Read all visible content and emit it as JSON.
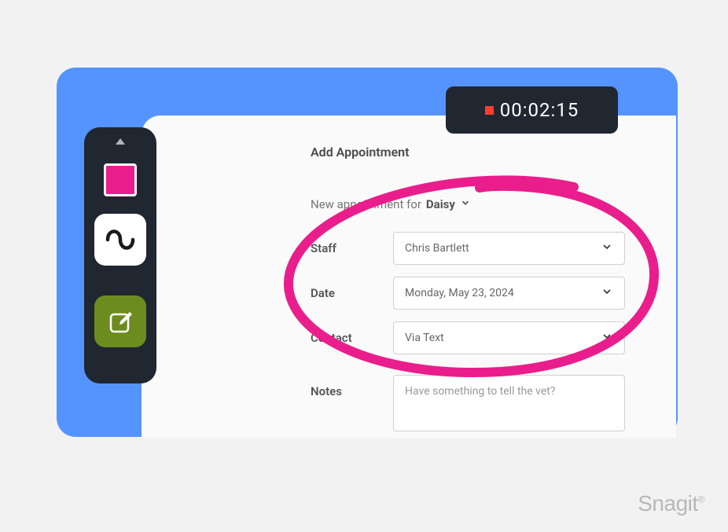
{
  "form": {
    "title": "Add Appointment",
    "subtitle_prefix": "New appointment for",
    "subtitle_name": "Daisy",
    "rows": {
      "staff": {
        "label": "Staff",
        "value": "Chris Bartlett"
      },
      "date": {
        "label": "Date",
        "value": "Monday, May 23, 2024"
      },
      "contact": {
        "label": "Contact",
        "value": "Via Text"
      },
      "notes": {
        "label": "Notes",
        "placeholder": "Have something to tell the vet?"
      }
    }
  },
  "recording": {
    "time": "00:02:15"
  },
  "watermark": {
    "text": "Snagit"
  },
  "colors": {
    "blue_bg": "#5594ff",
    "toolbar_bg": "#202731",
    "magenta": "#e91e8c",
    "green": "#6d8c1f"
  }
}
